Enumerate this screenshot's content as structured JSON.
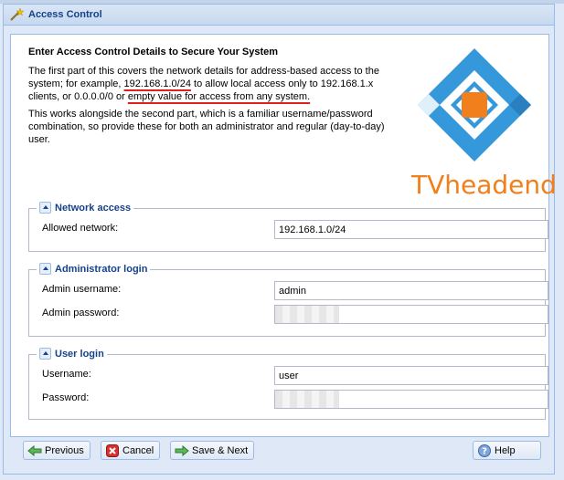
{
  "window": {
    "title": "Access Control"
  },
  "intro": {
    "heading": "Enter Access Control Details to Secure Your System",
    "p1_a": "The first part of this covers the network details for address-based access to the system; for example, ",
    "p1_highlight1": "192.168.1.0/24",
    "p1_b": " to allow local access only to 192.168.1.x clients, or 0.0.0.0/0 or ",
    "p1_highlight2": "empty value for access from any system.",
    "p2": "This works alongside the second part, which is a familiar username/password combination, so provide these for both an administrator and regular (day-to-day) user."
  },
  "logo": {
    "text": "TVheadend",
    "diamond_color": "#3598db",
    "square_color": "#f07f1c"
  },
  "network": {
    "legend": "Network access",
    "allowed_label": "Allowed network:",
    "allowed_value": "192.168.1.0/24"
  },
  "admin": {
    "legend": "Administrator login",
    "username_label": "Admin username:",
    "username_value": "admin",
    "password_label": "Admin password:"
  },
  "user": {
    "legend": "User login",
    "username_label": "Username:",
    "username_value": "user",
    "password_label": "Password:"
  },
  "buttons": {
    "previous": "Previous",
    "cancel": "Cancel",
    "save_next": "Save & Next",
    "help": "Help"
  },
  "colors": {
    "accent": "#15428b",
    "border": "#99bbe8",
    "underline": "#e0201e"
  }
}
